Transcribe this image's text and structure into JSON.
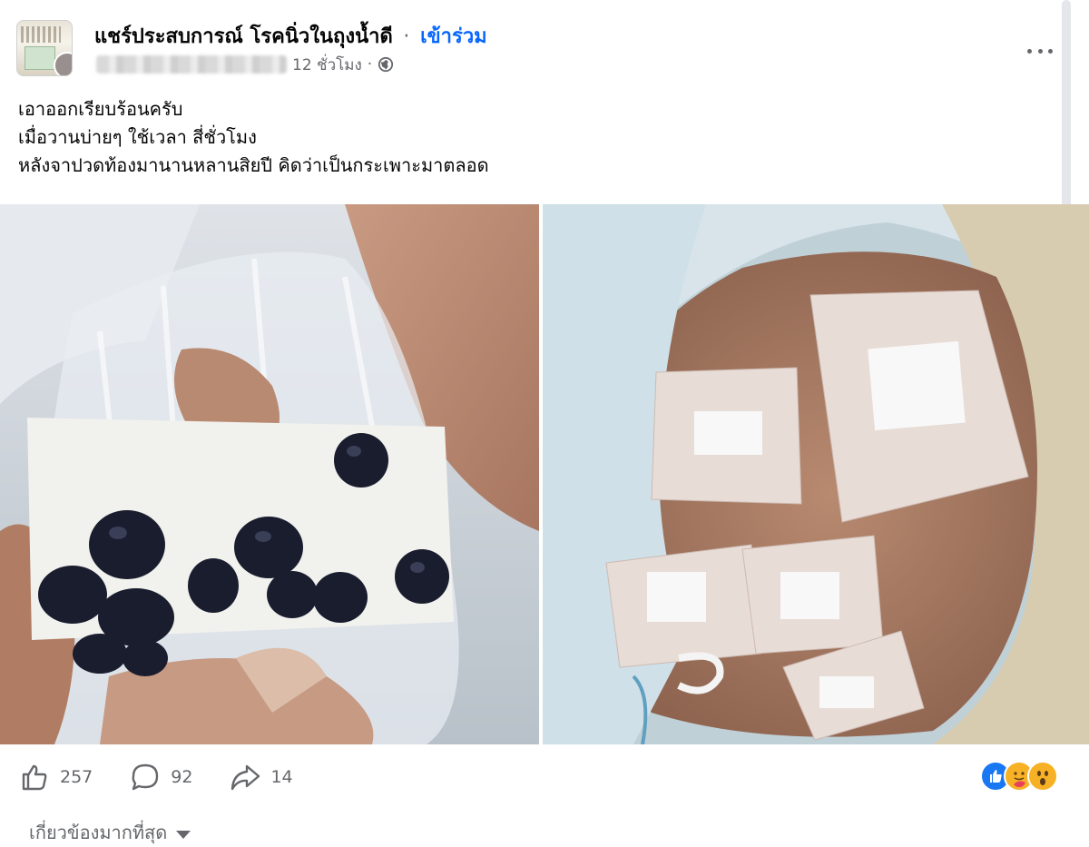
{
  "header": {
    "group_name": "แชร์ประสบการณ์ โรคนิ่วในถุงน้ำดี",
    "separator": "·",
    "join_label": "เข้าร่วม",
    "time": "12 ชั่วโมง",
    "time_separator": "·",
    "privacy_icon": "globe-icon",
    "more_icon": "more-icon"
  },
  "post": {
    "lines": [
      "เอาออกเรียบร้อนครับ",
      "เมื่อวานบ่ายๆ ใช้เวลา สี่ชั่วโมง",
      "หลังจาปวดท้องมานานหลานสิยปี คิดว่าเป็นกระเพาะมาตลอด"
    ]
  },
  "photos": {
    "left": "gallstones-in-bag-photo",
    "right": "abdomen-bandages-photo"
  },
  "stats": {
    "likes": "257",
    "comments": "92",
    "shares": "14"
  },
  "reactions": [
    "like-reaction",
    "care-reaction",
    "wow-reaction"
  ],
  "colors": {
    "accent": "#0866ff",
    "secondary_text": "#65676b",
    "like_blue": "#1877f2",
    "reaction_yellow": "#f7b125"
  },
  "comments_sort": {
    "label": "เกี่ยวข้องมากที่สุด"
  }
}
